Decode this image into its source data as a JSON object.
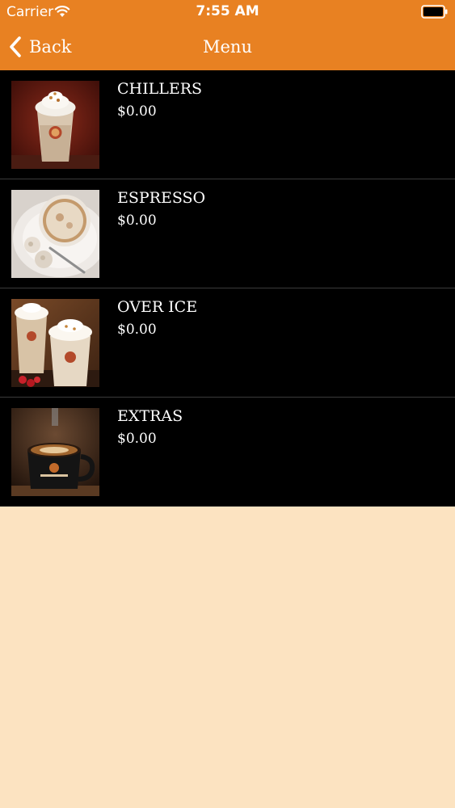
{
  "status_bar": {
    "carrier": "Carrier",
    "time": "7:55 AM"
  },
  "nav": {
    "back_label": "Back",
    "title": "Menu"
  },
  "menu": {
    "items": [
      {
        "name": "CHILLERS",
        "price": "$0.00",
        "image": "iced-blended-drink-photo"
      },
      {
        "name": "ESPRESSO",
        "price": "$0.00",
        "image": "cappuccino-cup-photo"
      },
      {
        "name": "OVER ICE",
        "price": "$0.00",
        "image": "iced-coffee-cups-photo"
      },
      {
        "name": "EXTRAS",
        "price": "$0.00",
        "image": "coffee-mug-photo"
      }
    ]
  },
  "colors": {
    "header": "#e88122",
    "list_background": "#000000",
    "page_background": "#fce3c1",
    "text": "#ffffff"
  }
}
